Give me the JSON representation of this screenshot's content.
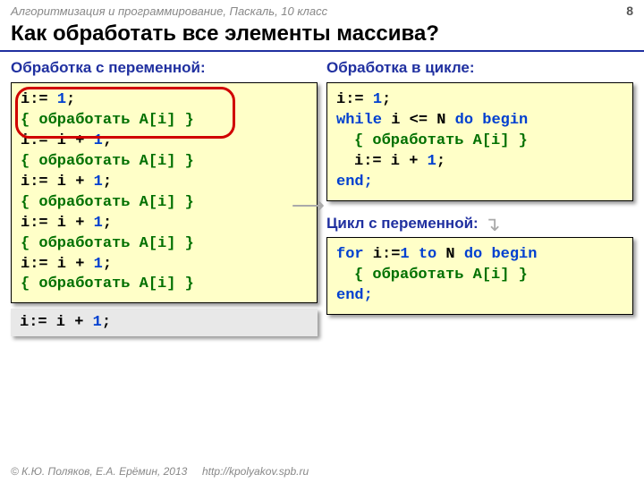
{
  "header": {
    "course": "Алгоритмизация и программирование, Паскаль, 10 класс",
    "page": "8"
  },
  "title": "Как обработать все элементы массива?",
  "left": {
    "heading": "Обработка с переменной:",
    "l1a": "i:= ",
    "l1b": "1",
    "l1c": ";",
    "l2": "{ обработать A[i] }",
    "l3a": "i:= i + ",
    "l3b": "1",
    "l3c": ";",
    "l4": "{ обработать A[i] }",
    "l5a": "i:= i + ",
    "l5b": "1",
    "l5c": ";",
    "l6": "{ обработать A[i] }",
    "l7a": "i:= i + ",
    "l7b": "1",
    "l7c": ";",
    "l8": "{ обработать A[i] }",
    "l9a": "i:= i + ",
    "l9b": "1",
    "l9c": ";",
    "l10": "{ обработать A[i] }",
    "gray_a": "i:= i + ",
    "gray_b": "1",
    "gray_c": ";"
  },
  "right": {
    "heading1": "Обработка в цикле:",
    "w1a": "i:= ",
    "w1b": "1",
    "w1c": ";",
    "w2a": "while",
    "w2b": " i <= N ",
    "w2c": "do begin",
    "w3": "{ обработать A[i] }",
    "w4a": "i:= i + ",
    "w4b": "1",
    "w4c": ";",
    "w5": "end;",
    "heading2": "Цикл с переменной:",
    "f1a": "for",
    "f1b": " i:=",
    "f1c": "1",
    "f1d": " to",
    "f1e": " N ",
    "f1f": "do begin",
    "f2": "{ обработать A[i] }",
    "f3": "end;"
  },
  "footer": {
    "copyright": "© К.Ю. Поляков, Е.А. Ерёмин, 2013",
    "url": "http://kpolyakov.spb.ru"
  }
}
